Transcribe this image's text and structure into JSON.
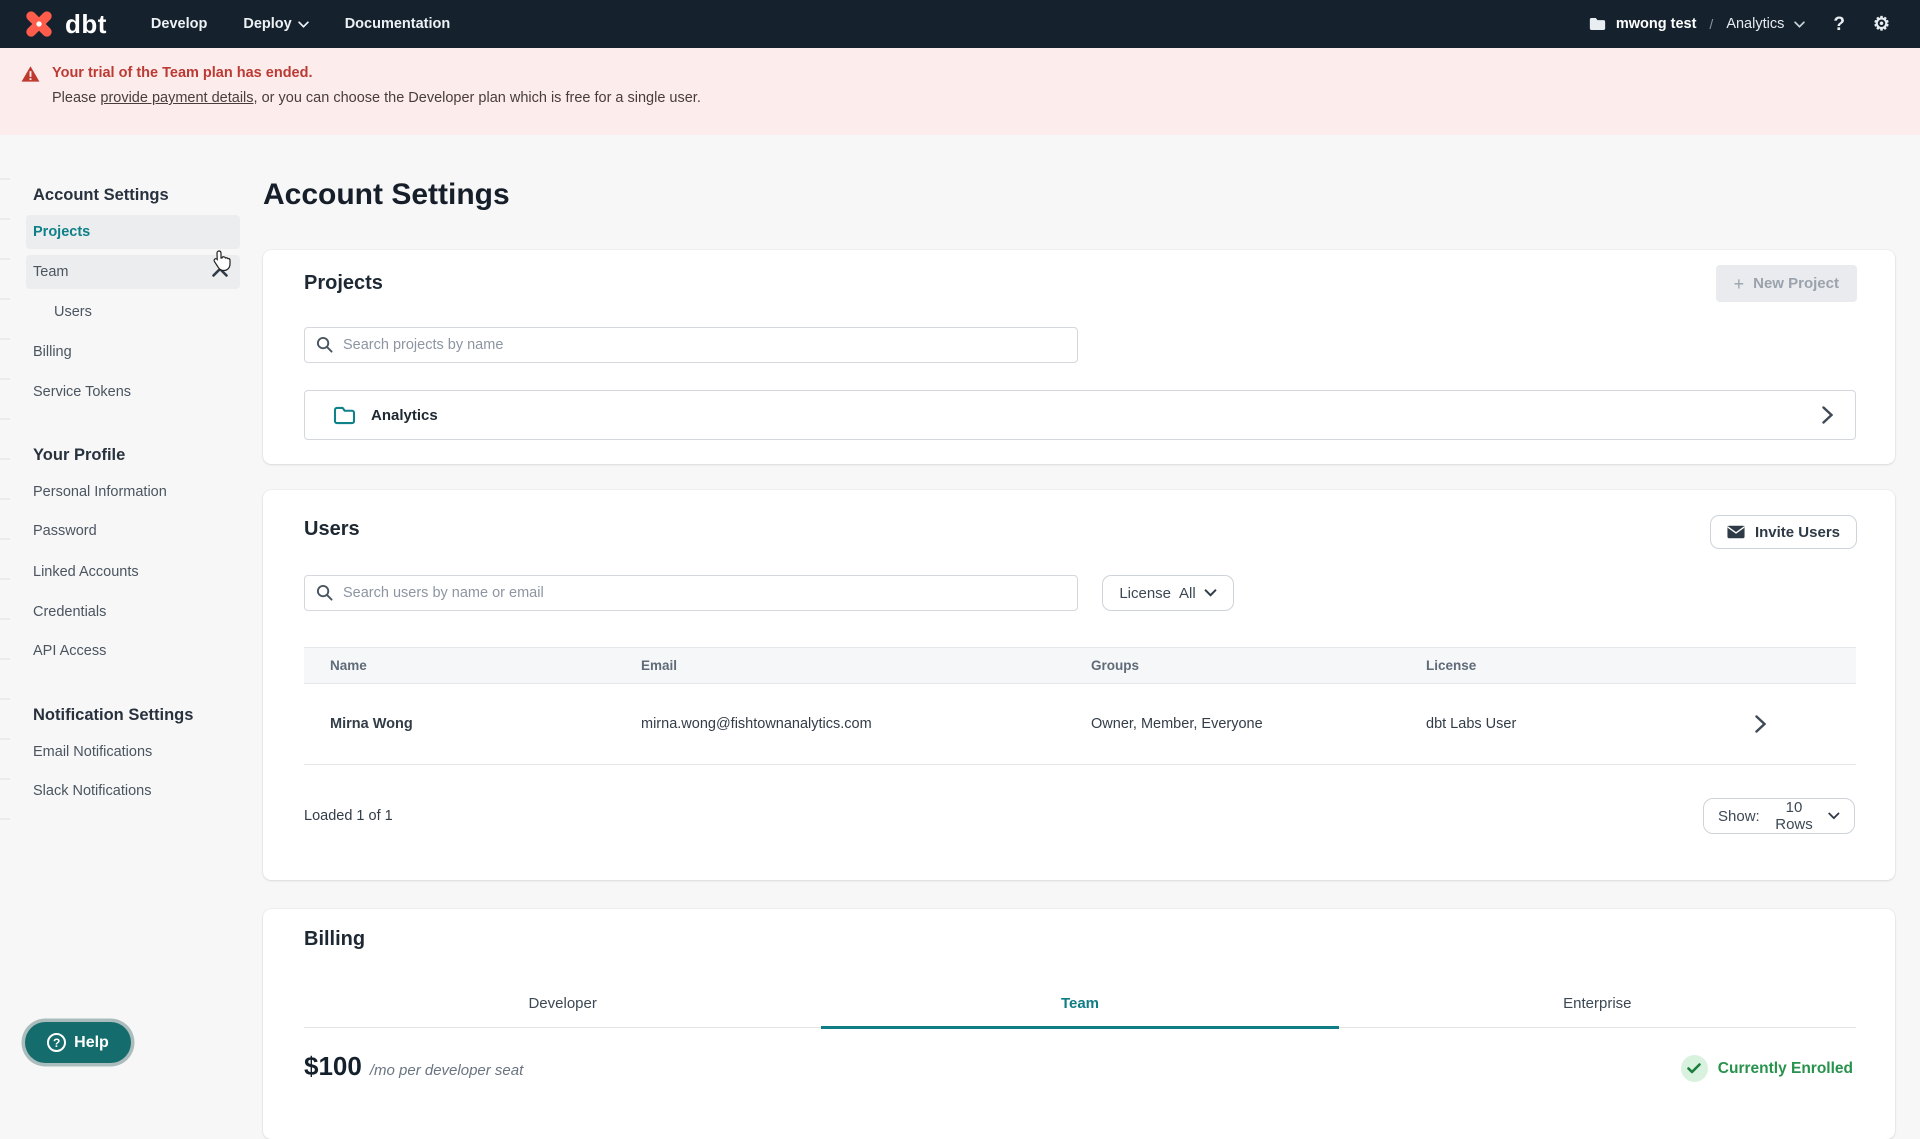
{
  "colors": {
    "accent_teal": "#0f8087",
    "nav_bg": "#15222e",
    "brand_orange": "#ff5c4c",
    "banner_bg": "#fcecec",
    "banner_red": "#bc3a34",
    "success_green": "#27924c"
  },
  "nav": {
    "brand": "dbt",
    "menu": [
      {
        "label": "Develop"
      },
      {
        "label": "Deploy"
      },
      {
        "label": "Documentation"
      }
    ],
    "account": "mwong test",
    "separator": "/",
    "project": "Analytics",
    "help_glyph": "?"
  },
  "banner": {
    "title": "Your trial of the Team plan has ended.",
    "body_prefix": "Please ",
    "link_text": "provide payment details",
    "body_suffix": ", or you can choose the Developer plan which is free for a single user."
  },
  "sidebar": {
    "sections": [
      {
        "heading": "Account Settings",
        "items": [
          {
            "label": "Projects"
          },
          {
            "label": "Team"
          },
          {
            "label": "Users"
          },
          {
            "label": "Billing"
          },
          {
            "label": "Service Tokens"
          }
        ]
      },
      {
        "heading": "Your Profile",
        "items": [
          {
            "label": "Personal Information"
          },
          {
            "label": "Password"
          },
          {
            "label": "Linked Accounts"
          },
          {
            "label": "Credentials"
          },
          {
            "label": "API Access"
          }
        ]
      },
      {
        "heading": "Notification Settings",
        "items": [
          {
            "label": "Email Notifications"
          },
          {
            "label": "Slack Notifications"
          }
        ]
      }
    ]
  },
  "page_title": "Account Settings",
  "projects_card": {
    "heading": "Projects",
    "new_project_button": "New Project",
    "search_placeholder": "Search projects by name",
    "projects": [
      {
        "name": "Analytics"
      }
    ]
  },
  "users_card": {
    "heading": "Users",
    "invite_button": "Invite Users",
    "search_placeholder": "Search users by name or email",
    "license_filter_label": "License",
    "license_filter_value": "All",
    "columns": [
      "Name",
      "Email",
      "Groups",
      "License"
    ],
    "rows": [
      {
        "name": "Mirna Wong",
        "email": "mirna.wong@fishtownanalytics.com",
        "groups": "Owner, Member, Everyone",
        "license": "dbt Labs User"
      }
    ],
    "loaded_text": "Loaded 1 of 1",
    "show_label": "Show:",
    "show_value": "10 Rows"
  },
  "billing_card": {
    "heading": "Billing",
    "tabs": [
      "Developer",
      "Team",
      "Enterprise"
    ],
    "active_tab": "Team",
    "price": "$100",
    "price_suffix": "/mo per developer seat",
    "enrolled_badge": "Currently Enrolled"
  },
  "help_button": {
    "label": "Help"
  }
}
